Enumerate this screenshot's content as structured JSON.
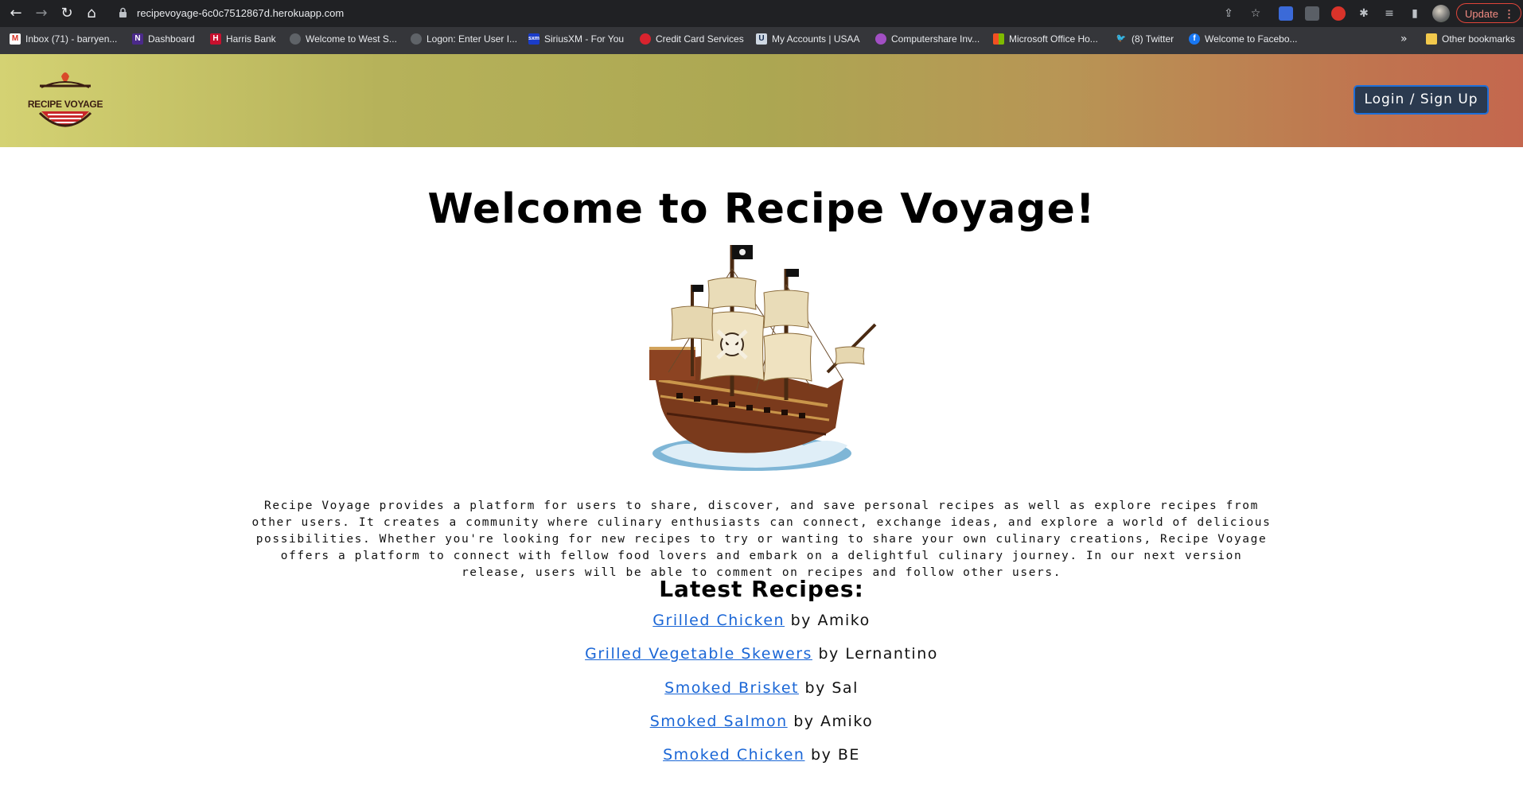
{
  "browser": {
    "url": "recipevoyage-6c0c7512867d.herokuapp.com",
    "update_label": "Update",
    "bookmarks": [
      {
        "label": "Inbox (71) - barryen..."
      },
      {
        "label": "Dashboard"
      },
      {
        "label": "Harris Bank"
      },
      {
        "label": "Welcome to West S..."
      },
      {
        "label": "Logon: Enter User I..."
      },
      {
        "label": "SiriusXM - For You"
      },
      {
        "label": "Credit Card Services"
      },
      {
        "label": "My Accounts | USAA"
      },
      {
        "label": "Computershare Inv..."
      },
      {
        "label": "Microsoft Office Ho..."
      },
      {
        "label": "(8) Twitter"
      },
      {
        "label": "Welcome to Facebo..."
      }
    ],
    "more_label": "»",
    "other_bookmarks_label": "Other bookmarks"
  },
  "header": {
    "logo_text": "RECIPE VOYAGE",
    "login_label": "Login / Sign Up"
  },
  "main": {
    "title": "Welcome to Recipe Voyage!",
    "intro": "Recipe Voyage provides a platform for users to share, discover, and save personal recipes as well as explore recipes from other users. It creates a community where culinary enthusiasts can connect, exchange ideas, and explore a world of delicious possibilities. Whether you're looking for new recipes to try or wanting to share your own culinary creations, Recipe Voyage offers a platform to connect with fellow food lovers and embark on a delightful culinary journey. In our next version release, users will be able to comment on recipes and follow other users.",
    "latest_heading": "Latest Recipes:",
    "recipes": [
      {
        "title": "Grilled Chicken",
        "author": "by Amiko"
      },
      {
        "title": "Grilled Vegetable Skewers",
        "author": "by Lernantino"
      },
      {
        "title": "Smoked Brisket",
        "author": "by Sal"
      },
      {
        "title": "Smoked Salmon",
        "author": "by Amiko"
      },
      {
        "title": "Smoked Chicken",
        "author": "by BE"
      }
    ]
  },
  "colors": {
    "link": "#1a66d6",
    "login_bg": "#2b3a4f",
    "header_left": "#d4d273",
    "header_right": "#c4674e"
  }
}
